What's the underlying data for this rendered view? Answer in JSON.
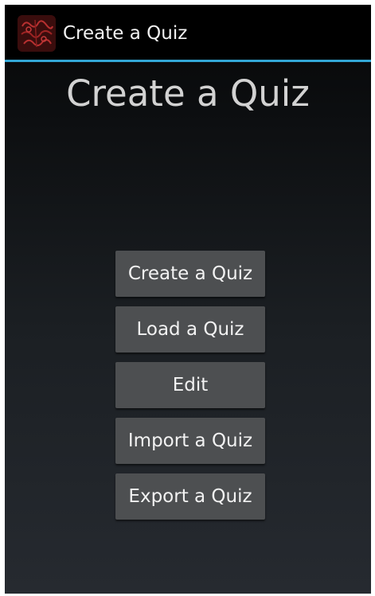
{
  "app_bar": {
    "icon": "quiz-app-icon",
    "title": "Create a Quiz"
  },
  "main": {
    "heading": "Create a Quiz",
    "buttons": [
      {
        "label": "Create a Quiz"
      },
      {
        "label": "Load a Quiz"
      },
      {
        "label": "Edit"
      },
      {
        "label": "Import a Quiz"
      },
      {
        "label": "Export a Quiz"
      }
    ]
  },
  "colors": {
    "action_bar": "#000000",
    "divider": "#33a7d6",
    "button": "#4d4f51",
    "heading_text": "#d2d2d2"
  }
}
